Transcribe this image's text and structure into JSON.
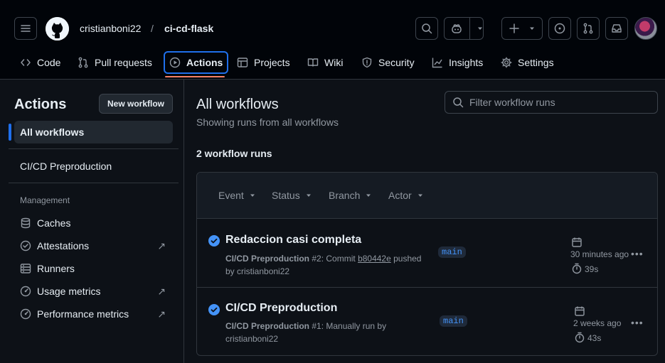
{
  "header": {
    "owner": "cristianboni22",
    "separator": "/",
    "repo": "ci-cd-flask"
  },
  "tabs": [
    {
      "label": "Code",
      "icon": "code-icon"
    },
    {
      "label": "Pull requests",
      "icon": "git-pull-request-icon"
    },
    {
      "label": "Actions",
      "icon": "play-icon",
      "active": true
    },
    {
      "label": "Projects",
      "icon": "table-icon"
    },
    {
      "label": "Wiki",
      "icon": "book-icon"
    },
    {
      "label": "Security",
      "icon": "shield-icon"
    },
    {
      "label": "Insights",
      "icon": "graph-icon"
    },
    {
      "label": "Settings",
      "icon": "gear-icon"
    }
  ],
  "sidebar": {
    "title": "Actions",
    "new_workflow": "New workflow",
    "all_workflows": "All workflows",
    "workflows": [
      "CI/CD Preproduction"
    ],
    "management_label": "Management",
    "management": [
      {
        "label": "Caches",
        "icon": "database-icon"
      },
      {
        "label": "Attestations",
        "icon": "verified-icon",
        "external": "↗"
      },
      {
        "label": "Runners",
        "icon": "server-icon"
      },
      {
        "label": "Usage metrics",
        "icon": "meter-icon",
        "external": "↗"
      },
      {
        "label": "Performance metrics",
        "icon": "meter-icon",
        "external": "↗"
      }
    ]
  },
  "main": {
    "title": "All workflows",
    "subtitle": "Showing runs from all workflows",
    "filter_placeholder": "Filter workflow runs",
    "runs_count": "2 workflow runs",
    "filters": [
      "Event",
      "Status",
      "Branch",
      "Actor"
    ],
    "runs": [
      {
        "title": "Redaccion casi completa",
        "workflow": "CI/CD Preproduction",
        "number": "#2",
        "desc_prefix": ": Commit ",
        "sha": "b80442e",
        "desc_suffix": " pushed",
        "by": "by cristianboni22",
        "branch": "main",
        "time": "30 minutes ago",
        "duration": "39s",
        "status": "success"
      },
      {
        "title": "CI/CD Preproduction",
        "workflow": "CI/CD Preproduction",
        "number": "#1",
        "desc_prefix": ": Manually run by",
        "sha": "",
        "desc_suffix": "",
        "by": "cristianboni22",
        "branch": "main",
        "time": "2 weeks ago",
        "duration": "43s",
        "status": "success"
      }
    ],
    "more": "•••"
  },
  "colors": {
    "bg": "#0d1117",
    "header_bg": "#010409",
    "accent": "#1f6feb",
    "success": "#4493f8",
    "tab_underline": "#f78166"
  }
}
